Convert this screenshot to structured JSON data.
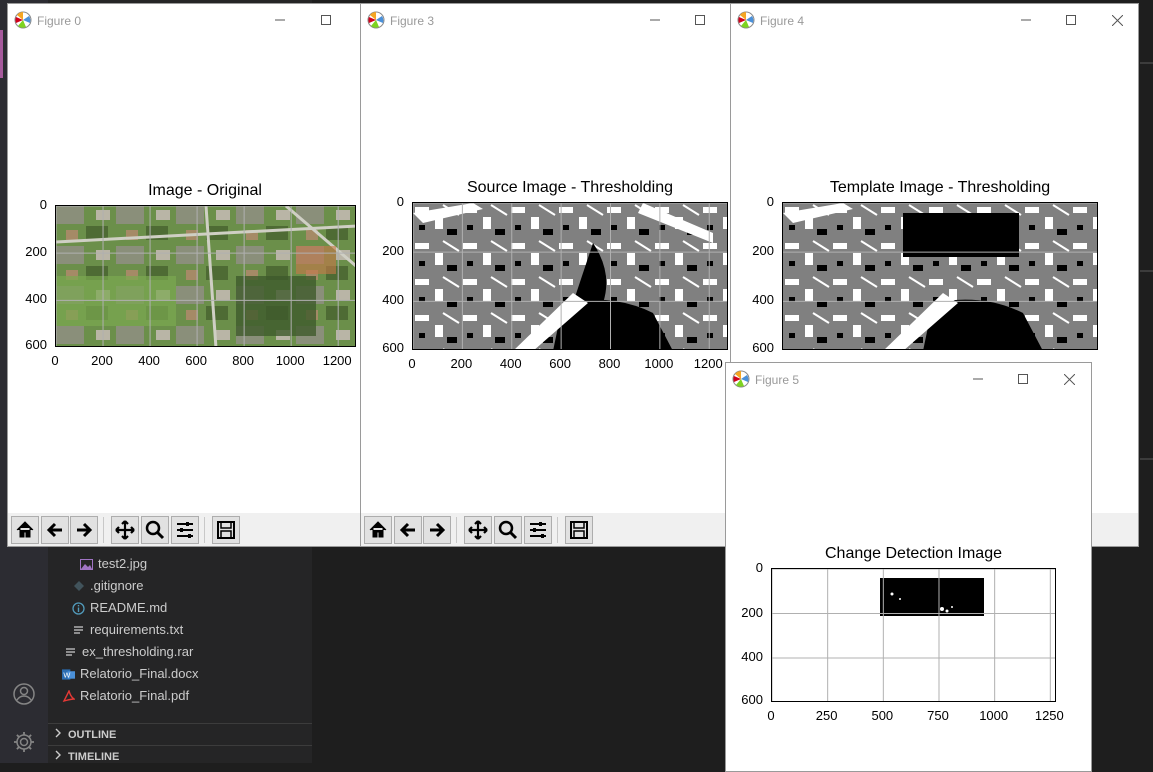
{
  "colors": {
    "vscode_sidebar": "#252526",
    "vscode_editor": "#1e1e1e",
    "activity_accent": "#a65a9c",
    "threshold_gray": "#808080"
  },
  "explorer": {
    "files": [
      {
        "name": "test2.jpg",
        "icon": "image-file-icon"
      },
      {
        "name": ".gitignore",
        "icon": "git-file-icon"
      },
      {
        "name": "README.md",
        "icon": "info-file-icon"
      },
      {
        "name": "requirements.txt",
        "icon": "text-file-icon"
      },
      {
        "name": "ex_thresholding.rar",
        "icon": "text-file-icon"
      },
      {
        "name": "Relatorio_Final.docx",
        "icon": "word-file-icon"
      },
      {
        "name": "Relatorio_Final.pdf",
        "icon": "pdf-file-icon"
      }
    ],
    "outline_label": "OUTLINE",
    "timeline_label": "TIMELINE"
  },
  "windows": {
    "fig0": {
      "title": "Figure 0",
      "plot_title": "Image - Original",
      "yticks": [
        "0",
        "200",
        "400",
        "600"
      ],
      "xticks": [
        "0",
        "200",
        "400",
        "600",
        "800",
        "1000",
        "1200"
      ]
    },
    "fig3": {
      "title": "Figure 3",
      "plot_title": "Source Image - Thresholding",
      "yticks": [
        "0",
        "200",
        "400",
        "600"
      ],
      "xticks": [
        "0",
        "200",
        "400",
        "600",
        "800",
        "1000",
        "1200"
      ]
    },
    "fig4": {
      "title": "Figure 4",
      "plot_title": "Template Image - Thresholding",
      "yticks": [
        "0",
        "200",
        "400",
        "600"
      ]
    },
    "fig5": {
      "title": "Figure 5",
      "plot_title": "Change Detection Image",
      "yticks": [
        "0",
        "200",
        "400",
        "600"
      ],
      "xticks": [
        "0",
        "250",
        "500",
        "750",
        "1000",
        "1250"
      ]
    }
  },
  "toolbar_buttons": [
    "home-icon",
    "back-arrow-icon",
    "forward-arrow-icon",
    "pan-icon",
    "zoom-icon",
    "configure-subplots-icon",
    "save-icon"
  ]
}
